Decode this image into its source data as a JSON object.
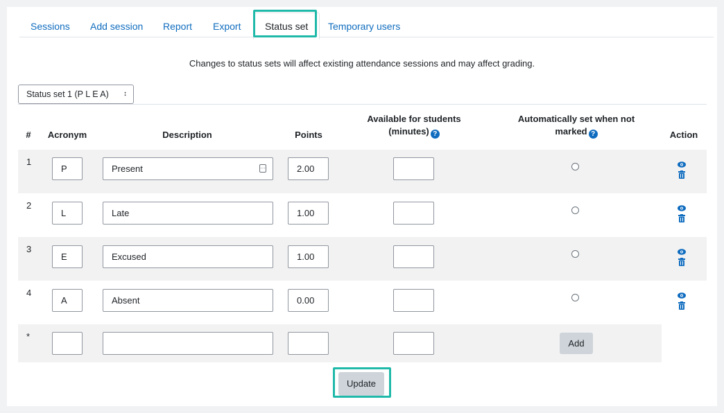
{
  "tabs": [
    "Sessions",
    "Add session",
    "Report",
    "Export",
    "Status set",
    "Temporary users"
  ],
  "active_tab": "Status set",
  "notice": "Changes to status sets will affect existing attendance sessions and may affect grading.",
  "status_set_select": {
    "value": "Status set 1 (P L E A)",
    "arrow": "↕"
  },
  "table": {
    "headers": {
      "num": "#",
      "acronym": "Acronym",
      "description": "Description",
      "points": "Points",
      "available_line1": "Available for students",
      "available_line2": "(minutes)",
      "auto_line1": "Automatically set when not",
      "auto_line2": "marked",
      "action": "Action"
    },
    "rows": [
      {
        "num": "1",
        "acronym": "P",
        "description": "Present",
        "points": "2.00",
        "minutes": ""
      },
      {
        "num": "2",
        "acronym": "L",
        "description": "Late",
        "points": "1.00",
        "minutes": ""
      },
      {
        "num": "3",
        "acronym": "E",
        "description": "Excused",
        "points": "1.00",
        "minutes": ""
      },
      {
        "num": "4",
        "acronym": "A",
        "description": "Absent",
        "points": "0.00",
        "minutes": ""
      }
    ],
    "new_row": {
      "num": "*",
      "acronym": "",
      "description": "",
      "points": "",
      "minutes": "",
      "add_label": "Add"
    }
  },
  "update_label": "Update",
  "colors": {
    "link": "#0f6cbf",
    "highlight": "#1fb9a9",
    "row_shade": "#f2f2f2",
    "button": "#ced4da"
  },
  "icons": {
    "help": "question-circle-icon",
    "show": "eye-icon",
    "delete": "trash-icon",
    "counter": "input-helper-icon"
  }
}
